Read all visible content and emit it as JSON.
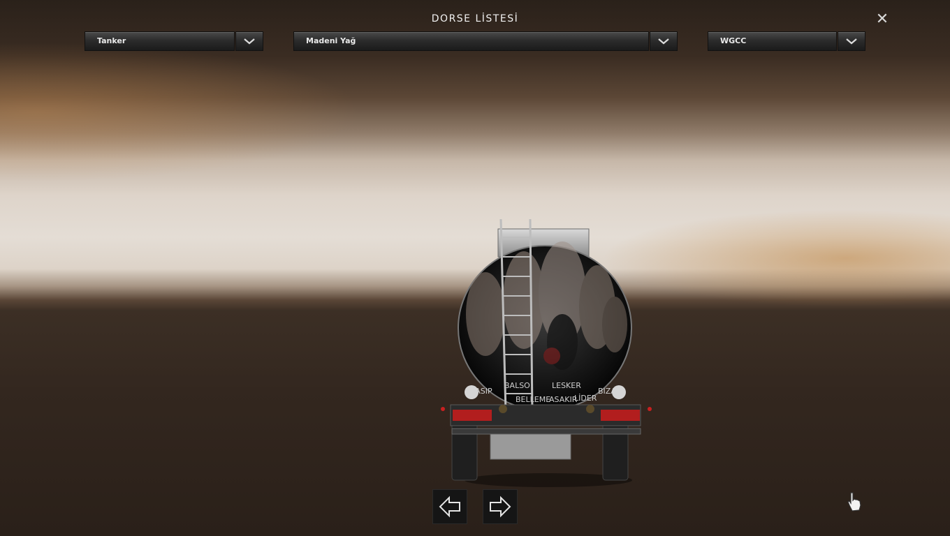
{
  "title": "DORSE LİSTESİ",
  "close_icon": "close-icon",
  "dropdowns": {
    "trailer_type": {
      "value": "Tanker"
    },
    "cargo": {
      "value": "Madeni Yağ"
    },
    "company": {
      "value": "WGCC"
    }
  },
  "trailer_decal_text": [
    "HASIP",
    "BALSO",
    "BELLEME",
    "LESKER",
    "ASAKIR",
    "LİDER",
    "BIZAN"
  ],
  "navigation": {
    "previous_icon": "arrow-left-icon",
    "next_icon": "arrow-right-icon"
  },
  "colors": {
    "panel": "#1b1b1b",
    "text": "#f2f2f2",
    "taillight": "#b21e1e"
  }
}
